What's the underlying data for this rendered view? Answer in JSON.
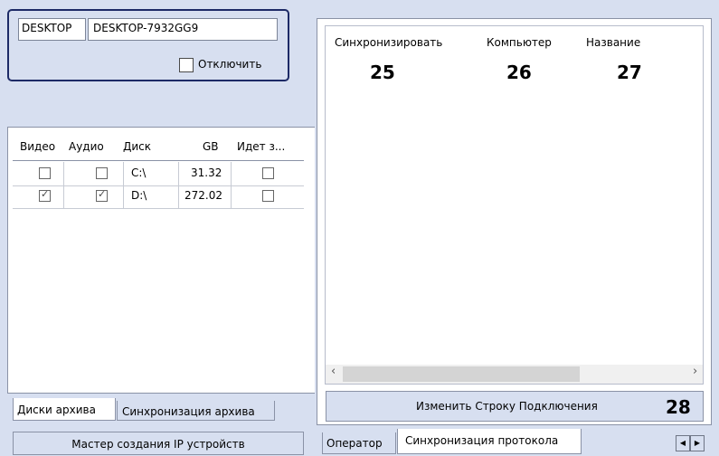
{
  "server": {
    "host_label": "DESKTOP",
    "host_value": "DESKTOP-7932GG9",
    "disable_label": "Отключить",
    "disable_checked": false
  },
  "disks_table": {
    "columns": [
      "Видео",
      "Аудио",
      "Диск",
      "GB",
      "Идет з..."
    ],
    "rows": [
      {
        "video": false,
        "audio": false,
        "disk": "C:\\",
        "gb": "31.32",
        "writing": false
      },
      {
        "video": true,
        "audio": true,
        "disk": "D:\\",
        "gb": "272.02",
        "writing": false
      }
    ]
  },
  "left_tabs": [
    "Диски архива",
    "Синхронизация архива"
  ],
  "wizard_button": "Мастер создания IP устройств",
  "sync_list": {
    "columns": [
      "Синхронизировать",
      "Компьютер",
      "Название"
    ],
    "callouts": [
      "25",
      "26",
      "27"
    ]
  },
  "change_connection_button": "Изменить Строку Подключения",
  "change_connection_callout": "28",
  "bottom_tabs": [
    "Оператор",
    "Синхронизация протокола"
  ],
  "icons": {
    "scroll_left": "chevron-left-icon",
    "scroll_right": "chevron-right-icon",
    "tab_prev": "triangle-left-icon",
    "tab_next": "triangle-right-icon"
  }
}
